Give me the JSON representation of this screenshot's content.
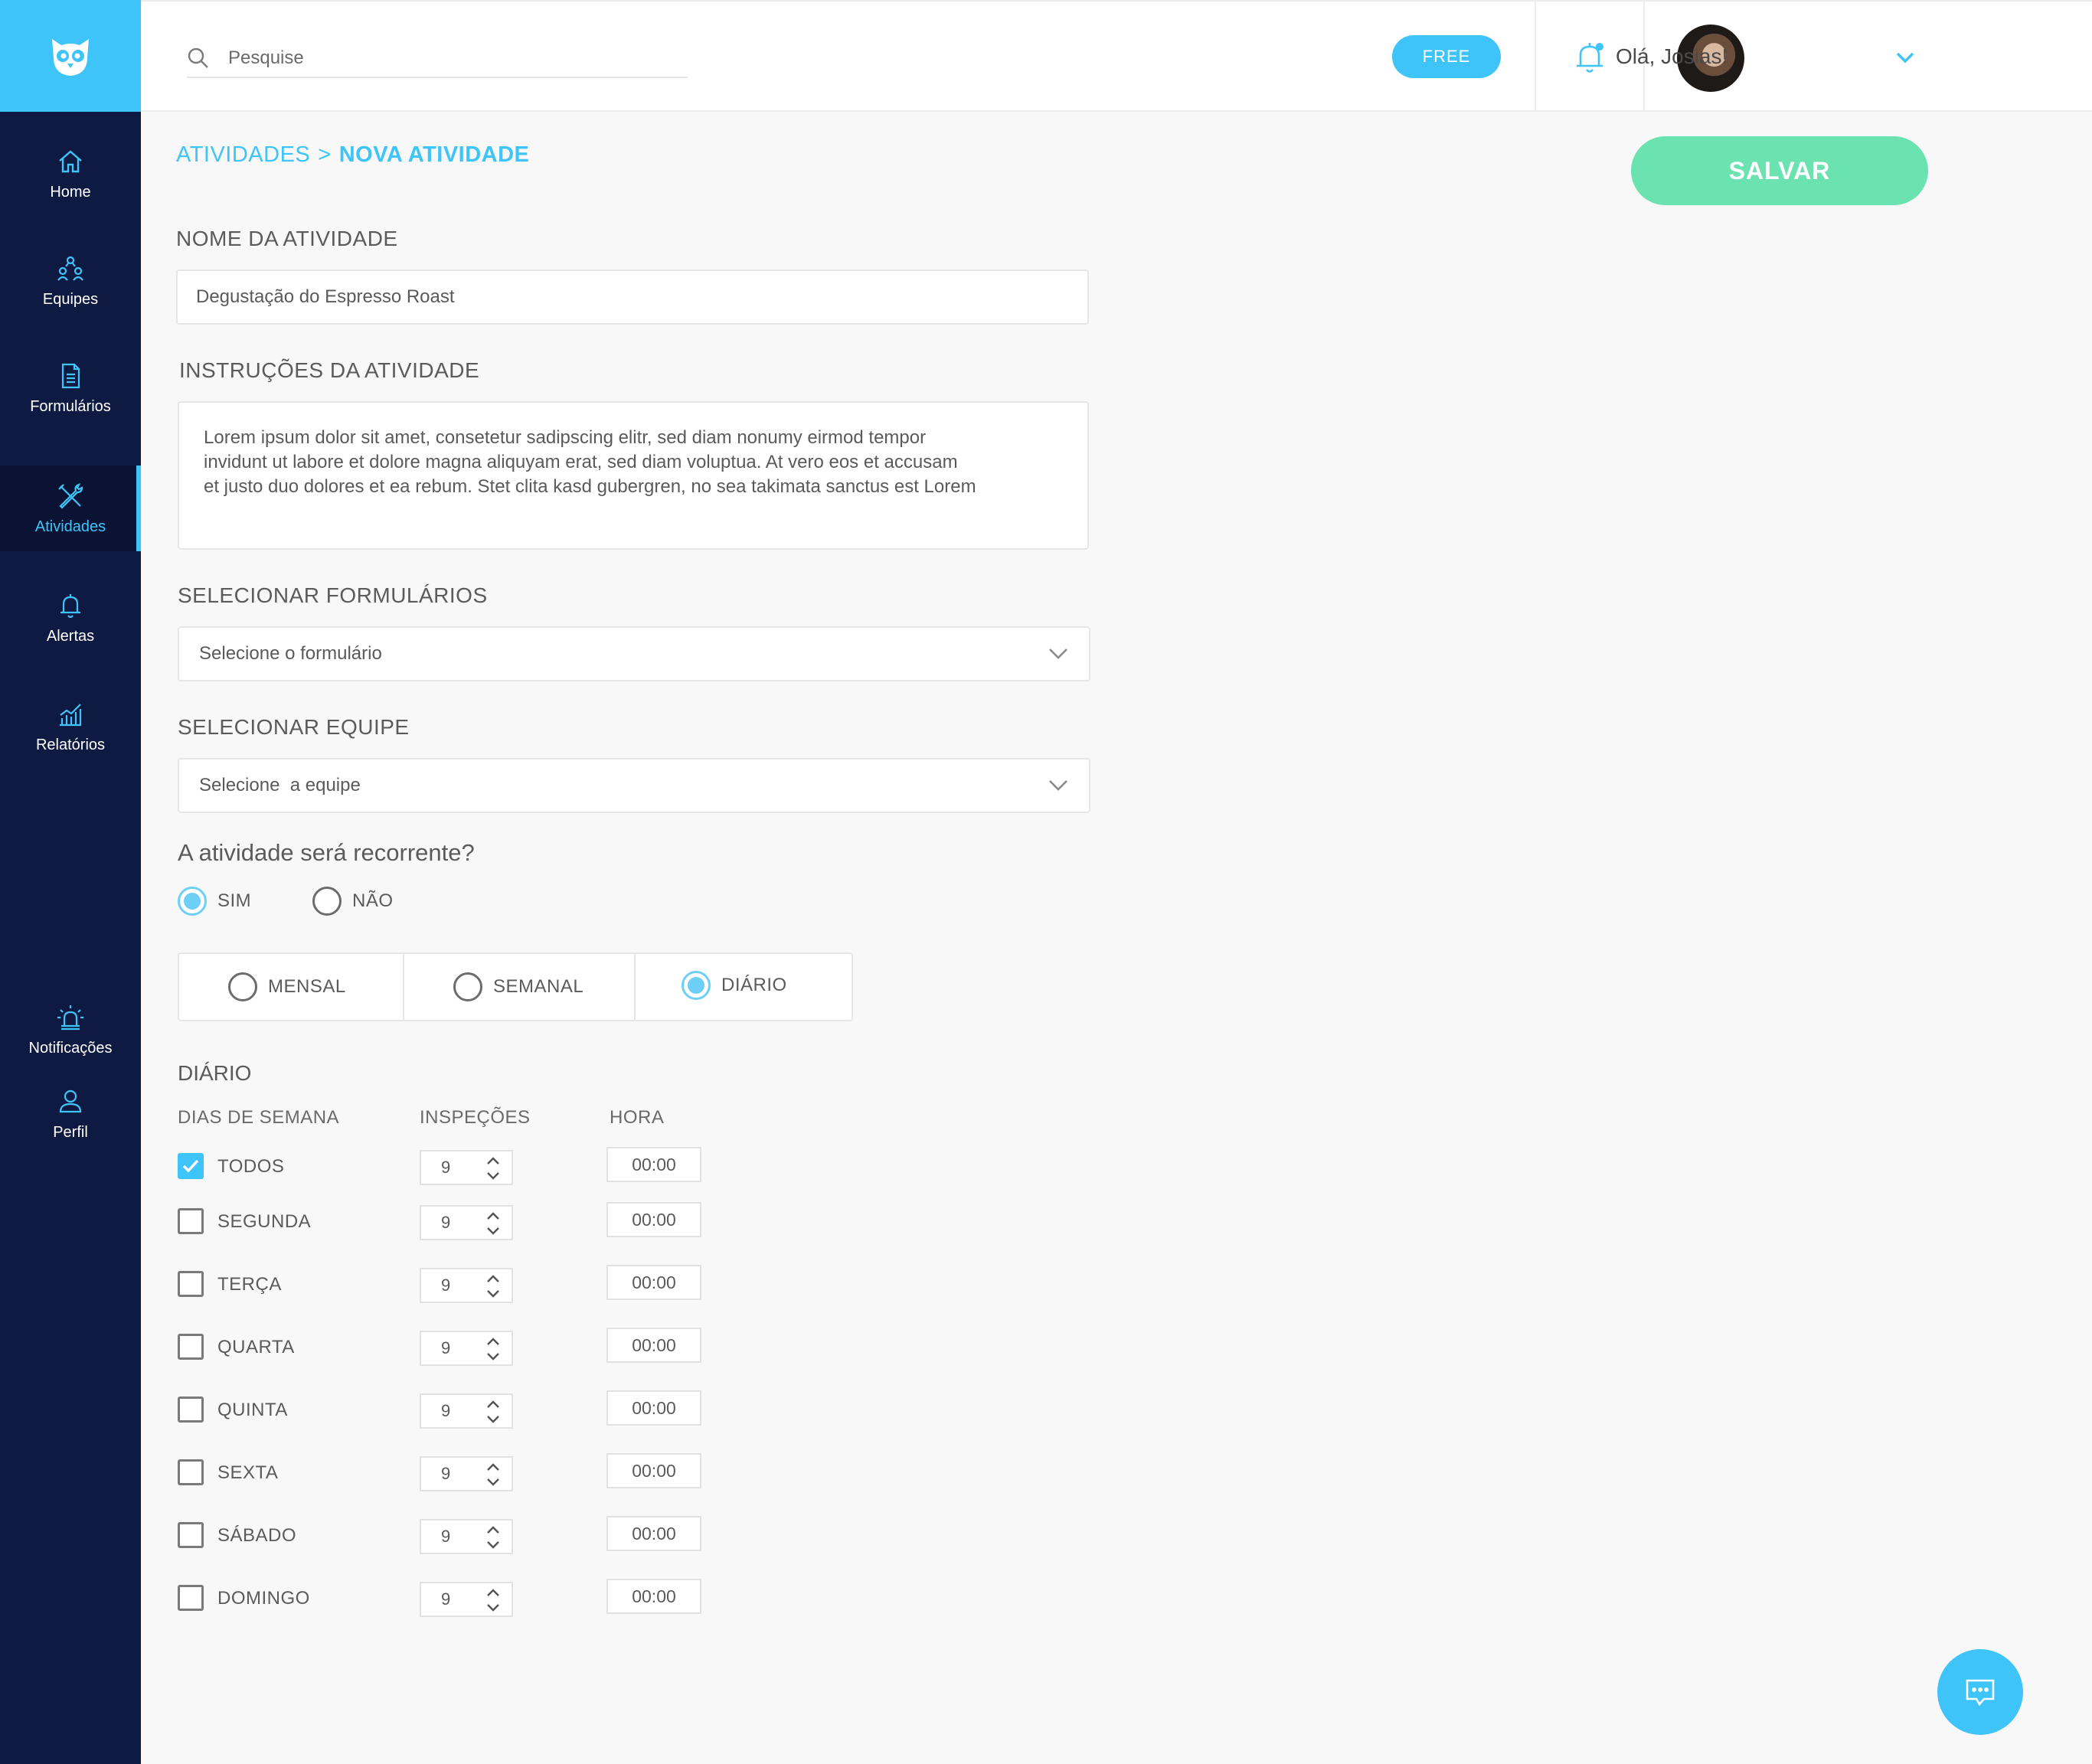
{
  "sidebar": {
    "items": [
      {
        "label": "Home",
        "icon": "home-icon"
      },
      {
        "label": "Equipes",
        "icon": "team-icon"
      },
      {
        "label": "Formulários",
        "icon": "form-icon"
      },
      {
        "label": "Atividades",
        "icon": "tools-icon",
        "active": true
      },
      {
        "label": "Alertas",
        "icon": "bell-icon"
      },
      {
        "label": "Relatórios",
        "icon": "chart-icon"
      },
      {
        "label": "Notificações",
        "icon": "alarm-icon"
      },
      {
        "label": "Perfil",
        "icon": "user-icon"
      }
    ]
  },
  "header": {
    "search_placeholder": "Pesquise",
    "plan_badge": "FREE",
    "greeting": "Olá, Josias!"
  },
  "breadcrumb": {
    "parent": "ATIVIDADES",
    "separator": ">",
    "current": "NOVA ATIVIDADE"
  },
  "save_label": "SALVAR",
  "form": {
    "name_label": "NOME DA ATIVIDADE",
    "name_value": "Degustação do Espresso Roast",
    "instructions_label": "INSTRUÇÕES DA ATIVIDADE",
    "instructions_lines": [
      "Lorem ipsum dolor sit amet, consetetur sadipscing elitr, sed diam nonumy eirmod tempor",
      "invidunt ut labore et dolore magna aliquyam erat, sed diam voluptua. At vero eos et accusam",
      "et justo duo dolores et ea rebum. Stet clita kasd gubergren, no sea takimata sanctus est Lorem"
    ],
    "forms_label": "SELECIONAR FORMULÁRIOS",
    "forms_placeholder": "Selecione o formulário",
    "team_label": "SELECIONAR EQUIPE",
    "team_placeholder": "Selecione  a equipe",
    "recurring_question": "A atividade será recorrente?",
    "recurring_yes": "SIM",
    "recurring_no": "NÃO",
    "recurring_selected": "SIM",
    "frequency_options": [
      "MENSAL",
      "SEMANAL",
      "DIÁRIO"
    ],
    "frequency_selected": "DIÁRIO"
  },
  "schedule": {
    "title": "DIÁRIO",
    "columns": [
      "DIAS DE SEMANA",
      "INSPEÇÕES",
      "HORA"
    ],
    "rows": [
      {
        "day": "TODOS",
        "checked": true,
        "inspections": "9",
        "time": "00:00"
      },
      {
        "day": "SEGUNDA",
        "checked": false,
        "inspections": "9",
        "time": "00:00"
      },
      {
        "day": "TERÇA",
        "checked": false,
        "inspections": "9",
        "time": "00:00"
      },
      {
        "day": "QUARTA",
        "checked": false,
        "inspections": "9",
        "time": "00:00"
      },
      {
        "day": "QUINTA",
        "checked": false,
        "inspections": "9",
        "time": "00:00"
      },
      {
        "day": "SEXTA",
        "checked": false,
        "inspections": "9",
        "time": "00:00"
      },
      {
        "day": "SÁBADO",
        "checked": false,
        "inspections": "9",
        "time": "00:00"
      },
      {
        "day": "DOMINGO",
        "checked": false,
        "inspections": "9",
        "time": "00:00"
      }
    ]
  },
  "colors": {
    "accent": "#3ec4f8",
    "sidebar": "#0f1a42",
    "save": "#6ae3b0"
  }
}
